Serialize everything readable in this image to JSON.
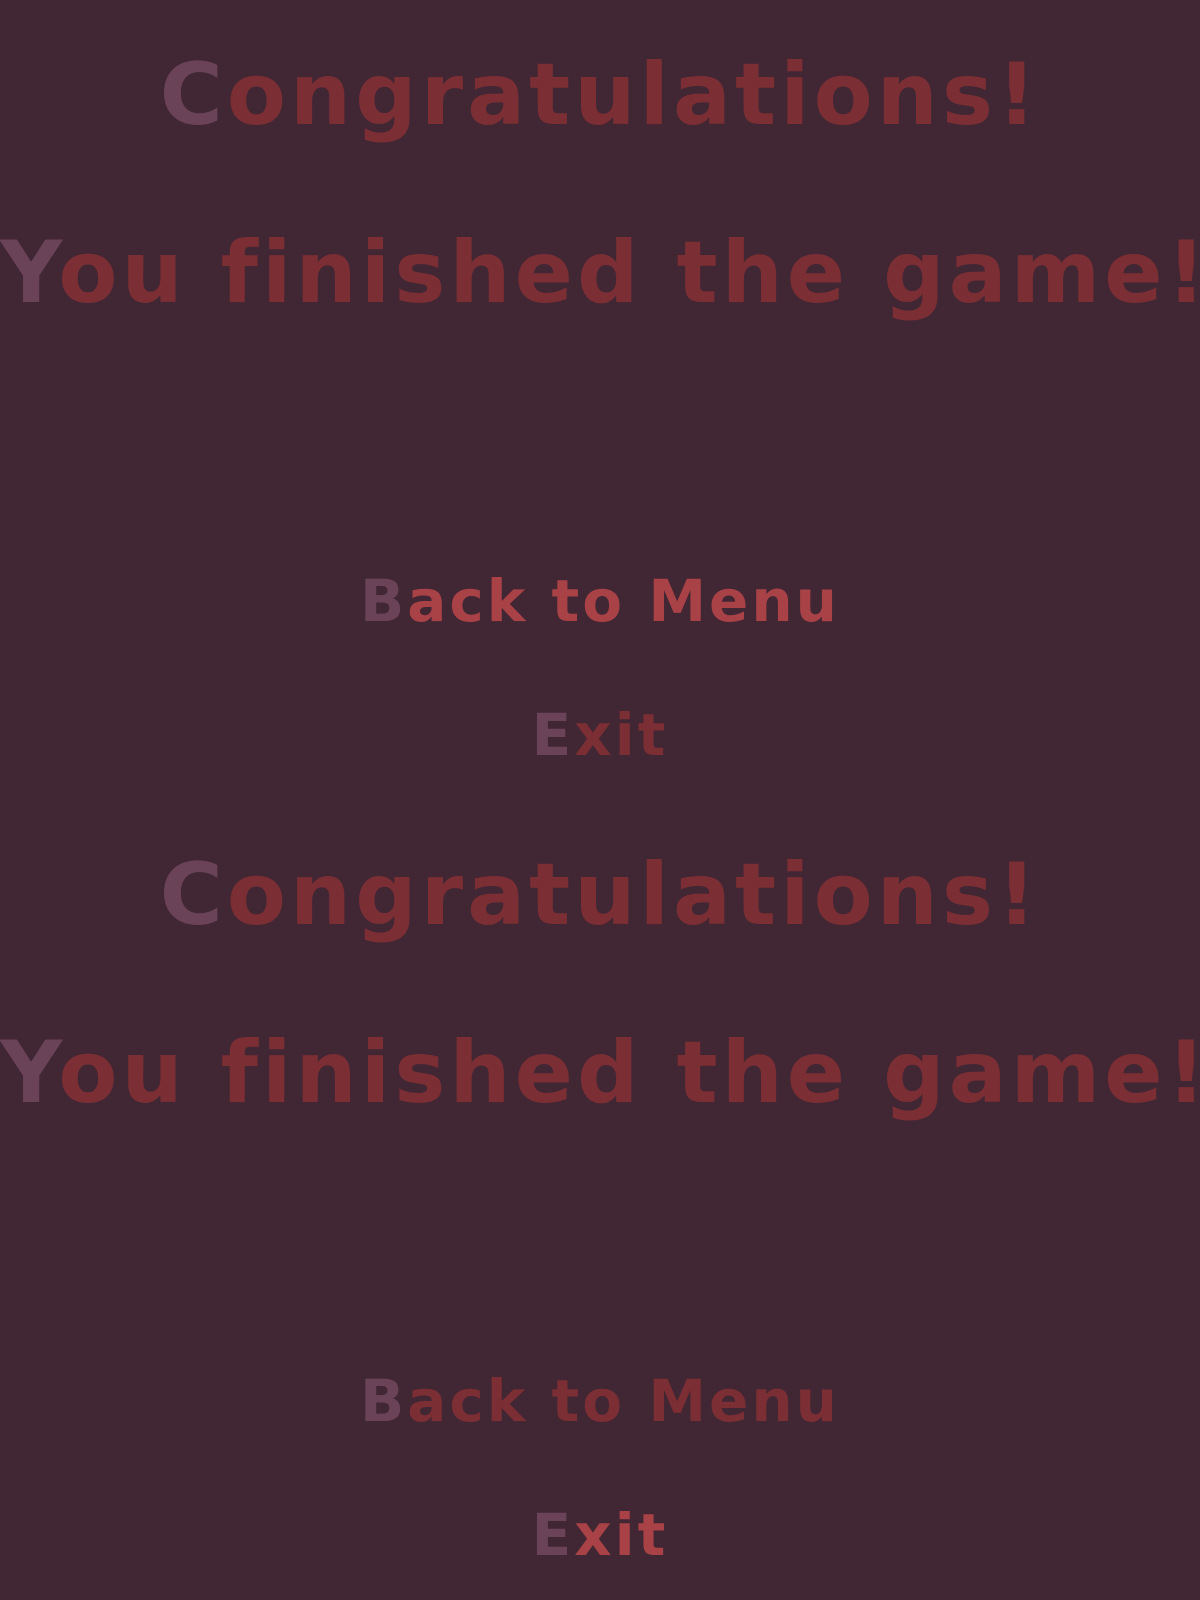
{
  "colors": {
    "background": "#412634",
    "first_letter": "#6b4358",
    "title_text": "#7b2e33",
    "menu_selected_text": "#a94246",
    "menu_idle_text": "#7b2e33"
  },
  "screens": [
    {
      "title_line_1": {
        "first": "C",
        "rest": "ongratulations!"
      },
      "title_line_2": {
        "first": "Y",
        "rest": "ou finished the game!"
      },
      "menu": [
        {
          "first": "B",
          "rest": "ack to Menu",
          "selected": true
        },
        {
          "first": "E",
          "rest": "xit",
          "selected": false
        }
      ]
    },
    {
      "title_line_1": {
        "first": "C",
        "rest": "ongratulations!"
      },
      "title_line_2": {
        "first": "Y",
        "rest": "ou finished the game!"
      },
      "menu": [
        {
          "first": "B",
          "rest": "ack to Menu",
          "selected": false
        },
        {
          "first": "E",
          "rest": "xit",
          "selected": true
        }
      ]
    }
  ]
}
